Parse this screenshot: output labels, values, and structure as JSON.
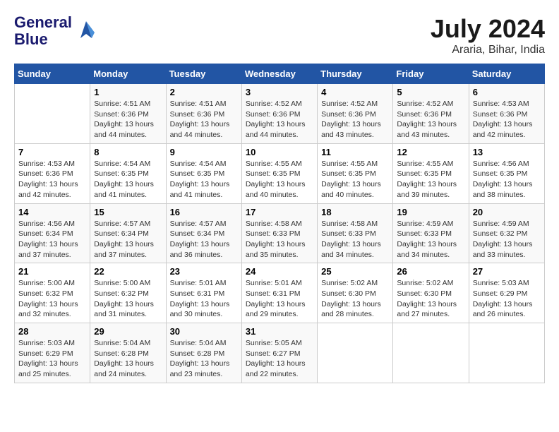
{
  "logo": {
    "line1": "General",
    "line2": "Blue"
  },
  "title": "July 2024",
  "subtitle": "Araria, Bihar, India",
  "days_header": [
    "Sunday",
    "Monday",
    "Tuesday",
    "Wednesday",
    "Thursday",
    "Friday",
    "Saturday"
  ],
  "weeks": [
    [
      {
        "num": "",
        "info": ""
      },
      {
        "num": "1",
        "info": "Sunrise: 4:51 AM\nSunset: 6:36 PM\nDaylight: 13 hours\nand 44 minutes."
      },
      {
        "num": "2",
        "info": "Sunrise: 4:51 AM\nSunset: 6:36 PM\nDaylight: 13 hours\nand 44 minutes."
      },
      {
        "num": "3",
        "info": "Sunrise: 4:52 AM\nSunset: 6:36 PM\nDaylight: 13 hours\nand 44 minutes."
      },
      {
        "num": "4",
        "info": "Sunrise: 4:52 AM\nSunset: 6:36 PM\nDaylight: 13 hours\nand 43 minutes."
      },
      {
        "num": "5",
        "info": "Sunrise: 4:52 AM\nSunset: 6:36 PM\nDaylight: 13 hours\nand 43 minutes."
      },
      {
        "num": "6",
        "info": "Sunrise: 4:53 AM\nSunset: 6:36 PM\nDaylight: 13 hours\nand 42 minutes."
      }
    ],
    [
      {
        "num": "7",
        "info": "Sunrise: 4:53 AM\nSunset: 6:36 PM\nDaylight: 13 hours\nand 42 minutes."
      },
      {
        "num": "8",
        "info": "Sunrise: 4:54 AM\nSunset: 6:35 PM\nDaylight: 13 hours\nand 41 minutes."
      },
      {
        "num": "9",
        "info": "Sunrise: 4:54 AM\nSunset: 6:35 PM\nDaylight: 13 hours\nand 41 minutes."
      },
      {
        "num": "10",
        "info": "Sunrise: 4:55 AM\nSunset: 6:35 PM\nDaylight: 13 hours\nand 40 minutes."
      },
      {
        "num": "11",
        "info": "Sunrise: 4:55 AM\nSunset: 6:35 PM\nDaylight: 13 hours\nand 40 minutes."
      },
      {
        "num": "12",
        "info": "Sunrise: 4:55 AM\nSunset: 6:35 PM\nDaylight: 13 hours\nand 39 minutes."
      },
      {
        "num": "13",
        "info": "Sunrise: 4:56 AM\nSunset: 6:35 PM\nDaylight: 13 hours\nand 38 minutes."
      }
    ],
    [
      {
        "num": "14",
        "info": "Sunrise: 4:56 AM\nSunset: 6:34 PM\nDaylight: 13 hours\nand 37 minutes."
      },
      {
        "num": "15",
        "info": "Sunrise: 4:57 AM\nSunset: 6:34 PM\nDaylight: 13 hours\nand 37 minutes."
      },
      {
        "num": "16",
        "info": "Sunrise: 4:57 AM\nSunset: 6:34 PM\nDaylight: 13 hours\nand 36 minutes."
      },
      {
        "num": "17",
        "info": "Sunrise: 4:58 AM\nSunset: 6:33 PM\nDaylight: 13 hours\nand 35 minutes."
      },
      {
        "num": "18",
        "info": "Sunrise: 4:58 AM\nSunset: 6:33 PM\nDaylight: 13 hours\nand 34 minutes."
      },
      {
        "num": "19",
        "info": "Sunrise: 4:59 AM\nSunset: 6:33 PM\nDaylight: 13 hours\nand 34 minutes."
      },
      {
        "num": "20",
        "info": "Sunrise: 4:59 AM\nSunset: 6:32 PM\nDaylight: 13 hours\nand 33 minutes."
      }
    ],
    [
      {
        "num": "21",
        "info": "Sunrise: 5:00 AM\nSunset: 6:32 PM\nDaylight: 13 hours\nand 32 minutes."
      },
      {
        "num": "22",
        "info": "Sunrise: 5:00 AM\nSunset: 6:32 PM\nDaylight: 13 hours\nand 31 minutes."
      },
      {
        "num": "23",
        "info": "Sunrise: 5:01 AM\nSunset: 6:31 PM\nDaylight: 13 hours\nand 30 minutes."
      },
      {
        "num": "24",
        "info": "Sunrise: 5:01 AM\nSunset: 6:31 PM\nDaylight: 13 hours\nand 29 minutes."
      },
      {
        "num": "25",
        "info": "Sunrise: 5:02 AM\nSunset: 6:30 PM\nDaylight: 13 hours\nand 28 minutes."
      },
      {
        "num": "26",
        "info": "Sunrise: 5:02 AM\nSunset: 6:30 PM\nDaylight: 13 hours\nand 27 minutes."
      },
      {
        "num": "27",
        "info": "Sunrise: 5:03 AM\nSunset: 6:29 PM\nDaylight: 13 hours\nand 26 minutes."
      }
    ],
    [
      {
        "num": "28",
        "info": "Sunrise: 5:03 AM\nSunset: 6:29 PM\nDaylight: 13 hours\nand 25 minutes."
      },
      {
        "num": "29",
        "info": "Sunrise: 5:04 AM\nSunset: 6:28 PM\nDaylight: 13 hours\nand 24 minutes."
      },
      {
        "num": "30",
        "info": "Sunrise: 5:04 AM\nSunset: 6:28 PM\nDaylight: 13 hours\nand 23 minutes."
      },
      {
        "num": "31",
        "info": "Sunrise: 5:05 AM\nSunset: 6:27 PM\nDaylight: 13 hours\nand 22 minutes."
      },
      {
        "num": "",
        "info": ""
      },
      {
        "num": "",
        "info": ""
      },
      {
        "num": "",
        "info": ""
      }
    ]
  ]
}
